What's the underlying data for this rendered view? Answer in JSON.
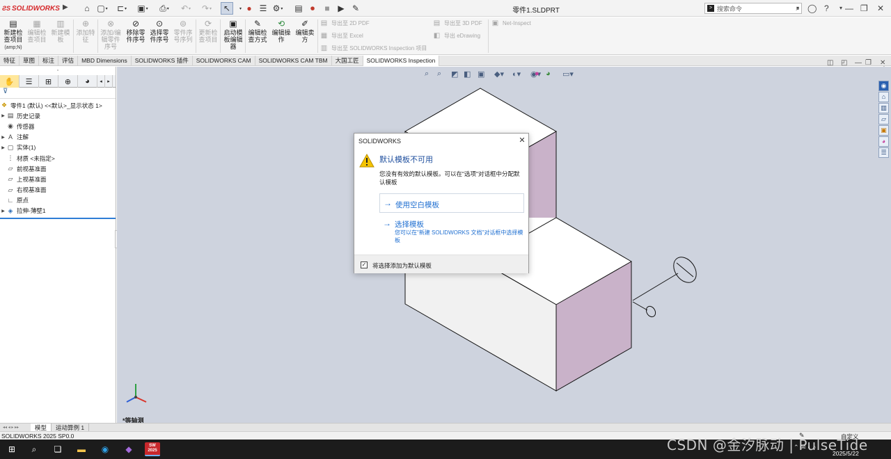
{
  "app": {
    "brand": "SOLIDWORKS",
    "window_title": "零件1.SLDPRT",
    "search_placeholder": "搜索命令"
  },
  "ribbon": {
    "buttons": [
      {
        "label": "新建检查项目",
        "sub": "(amp;N)",
        "enabled": true
      },
      {
        "label": "编辑检查项目",
        "enabled": false
      },
      {
        "label": "新建模板",
        "enabled": false
      },
      {
        "label": "添加特征",
        "enabled": false
      },
      {
        "label": "添加/编辑零件序号",
        "enabled": false
      },
      {
        "label": "移除零件序号",
        "enabled": true
      },
      {
        "label": "选择零件序号",
        "enabled": true
      },
      {
        "label": "零件序号序列",
        "enabled": false
      },
      {
        "label": "更新检查项目",
        "enabled": false
      },
      {
        "label": "启动模板编辑器",
        "enabled": true
      },
      {
        "label": "编辑检查方式",
        "enabled": true
      },
      {
        "label": "编辑操作",
        "enabled": true
      },
      {
        "label": "编辑卖方",
        "enabled": true
      }
    ],
    "exports": [
      {
        "label": "导出至 2D PDF"
      },
      {
        "label": "导出至 Excel"
      },
      {
        "label": "导出至 SOLIDWORKS Inspection 项目"
      },
      {
        "label": "导出至 3D PDF"
      },
      {
        "label": "导出 eDrawing"
      },
      {
        "label": "Net-Inspect"
      }
    ]
  },
  "tabs": [
    {
      "label": "特征",
      "active": false
    },
    {
      "label": "草图",
      "active": false
    },
    {
      "label": "标注",
      "active": false
    },
    {
      "label": "评估",
      "active": false
    },
    {
      "label": "MBD Dimensions",
      "active": false
    },
    {
      "label": "SOLIDWORKS 插件",
      "active": false
    },
    {
      "label": "SOLIDWORKS CAM",
      "active": false
    },
    {
      "label": "SOLIDWORKS CAM TBM",
      "active": false
    },
    {
      "label": "大国工匠",
      "active": false
    },
    {
      "label": "SOLIDWORKS Inspection",
      "active": true
    }
  ],
  "tree": {
    "root": "零件1 (默认) <<默认>_显示状态 1>",
    "items": [
      {
        "label": "历史记录",
        "icon": "history-icon",
        "expandable": true
      },
      {
        "label": "传感器",
        "icon": "sensor-icon",
        "expandable": false
      },
      {
        "label": "注解",
        "icon": "annotation-icon",
        "expandable": true
      },
      {
        "label": "实体(1)",
        "icon": "solid-body-icon",
        "expandable": true
      },
      {
        "label": "材质 <未指定>",
        "icon": "material-icon",
        "expandable": false
      },
      {
        "label": "前视基准面",
        "icon": "plane-icon",
        "expandable": false
      },
      {
        "label": "上视基准面",
        "icon": "plane-icon",
        "expandable": false
      },
      {
        "label": "右视基准面",
        "icon": "plane-icon",
        "expandable": false
      },
      {
        "label": "原点",
        "icon": "origin-icon",
        "expandable": false
      },
      {
        "label": "拉伸-薄壁1",
        "icon": "extrude-icon",
        "expandable": true
      }
    ]
  },
  "viewport": {
    "view_label": "*等轴测",
    "colors": {
      "background": "#ced3de",
      "side_face": "#c9b2c9",
      "top_face": "#ffffff",
      "edge": "#111111"
    }
  },
  "bottom_tabs": [
    {
      "label": "模型",
      "active": true
    },
    {
      "label": "运动算例 1",
      "active": false
    }
  ],
  "status": {
    "version": "SOLIDWORKS 2025 SP0.0",
    "units": "自定义"
  },
  "taskbar": {
    "sw_badge_top": "SW",
    "sw_badge_bottom": "2025",
    "date": "2025/5/22"
  },
  "watermark": "CSDN @金汐脉动 | PulseTide",
  "dialog": {
    "title": "SOLIDWORKS",
    "heading": "默认模板不可用",
    "message": "您没有有效的默认模板。可以在\"选项\"对话框中分配默认模板",
    "option1": "使用空白模板",
    "option2": "选择模板",
    "option2_sub": "您可以在\"新建 SOLIDWORKS 文档\"对话框中选择模板",
    "checkbox_label": "将选择添加为默认模板",
    "checkbox_checked": true
  }
}
